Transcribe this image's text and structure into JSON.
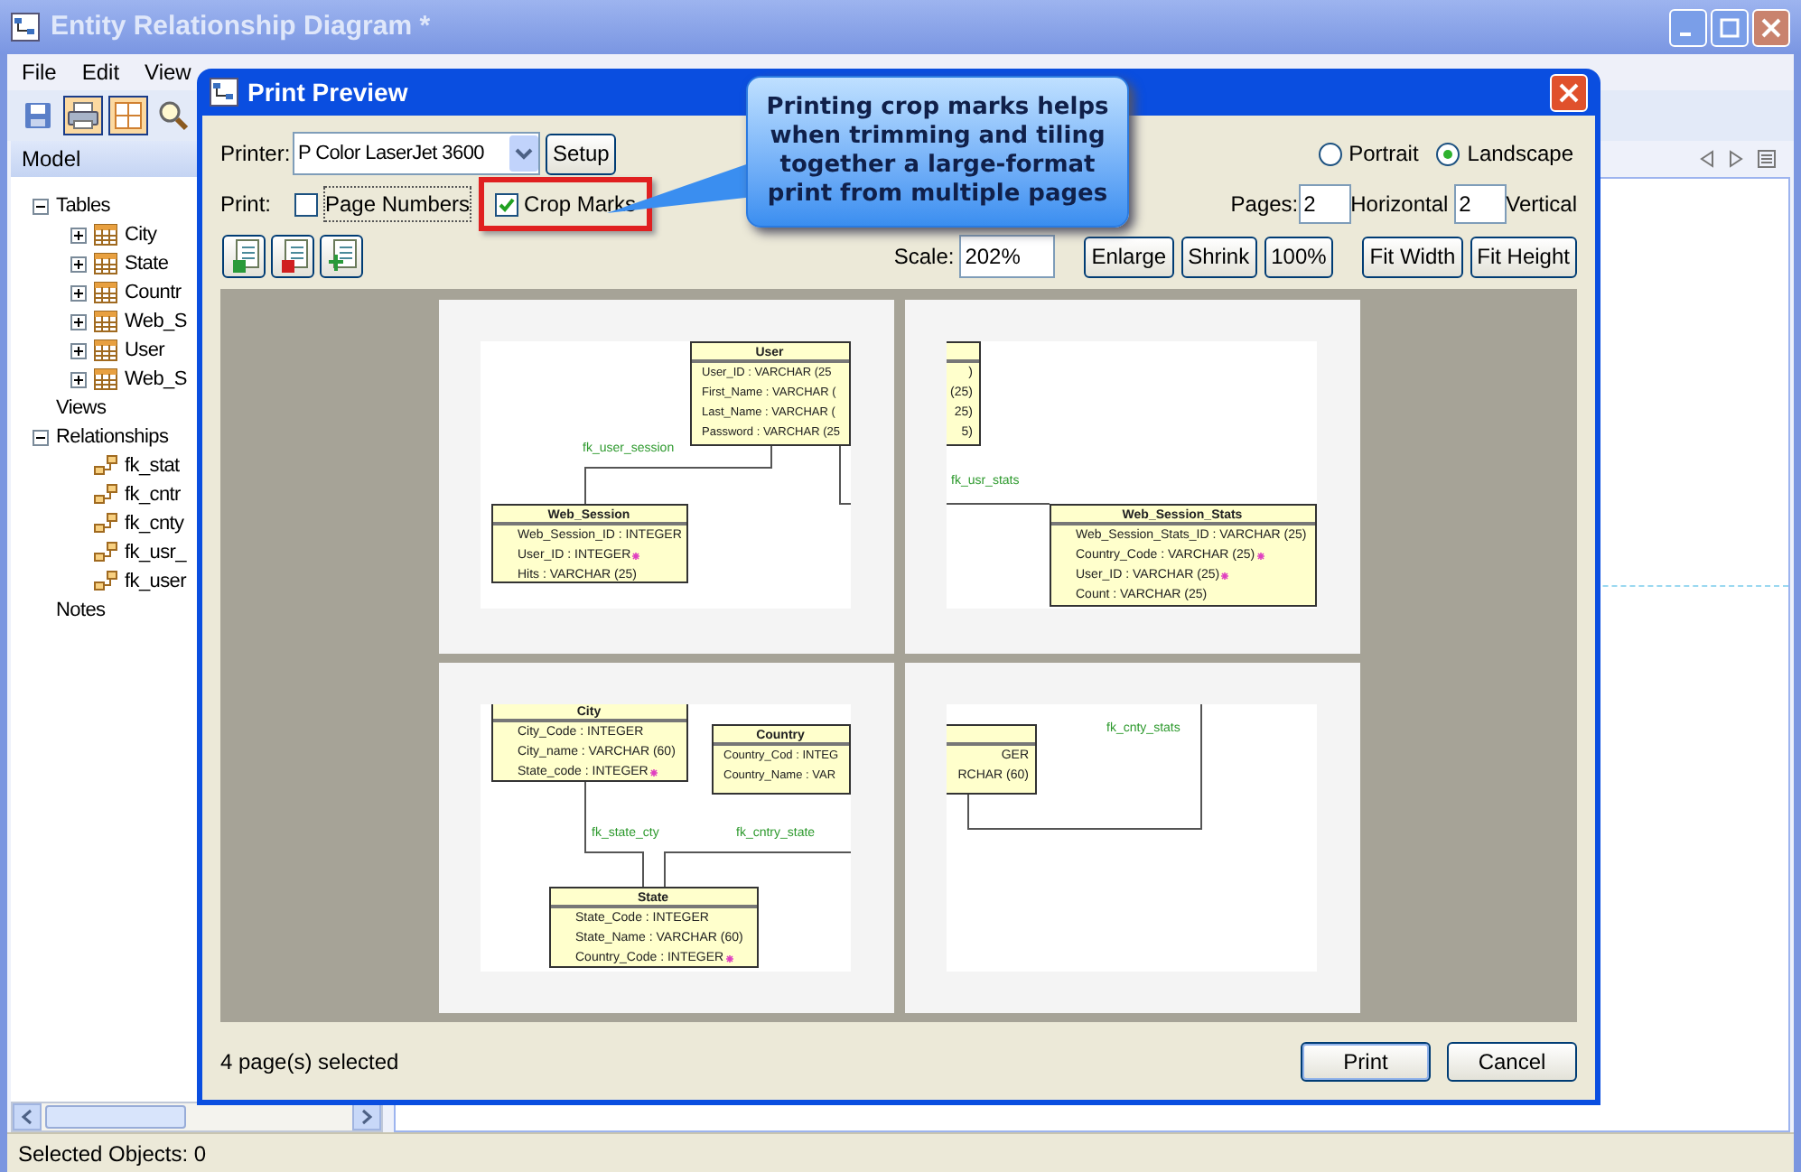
{
  "main_window": {
    "title": "Entity Relationship Diagram *"
  },
  "menu": [
    "File",
    "Edit",
    "View"
  ],
  "toolbar": [
    {
      "kind": "save",
      "pressed": false
    },
    {
      "kind": "print",
      "pressed": true
    },
    {
      "kind": "page",
      "pressed": true
    },
    {
      "kind": "zoom",
      "pressed": false
    }
  ],
  "model_panel": {
    "title": "Model",
    "tree": [
      {
        "label": "Tables",
        "kind": "folder",
        "expanded": true,
        "children": [
          {
            "label": "City",
            "kind": "table",
            "expanded": false
          },
          {
            "label": "State",
            "kind": "table",
            "expanded": false
          },
          {
            "label": "Countr",
            "kind": "table",
            "expanded": false
          },
          {
            "label": "Web_S",
            "kind": "table",
            "expanded": false
          },
          {
            "label": "User",
            "kind": "table",
            "expanded": false
          },
          {
            "label": "Web_S",
            "kind": "table",
            "expanded": false
          }
        ]
      },
      {
        "label": "Views",
        "kind": "plain"
      },
      {
        "label": "Relationships",
        "kind": "folder",
        "expanded": true,
        "children": [
          {
            "label": "fk_stat",
            "kind": "relation"
          },
          {
            "label": "fk_cntr",
            "kind": "relation"
          },
          {
            "label": "fk_cnty",
            "kind": "relation"
          },
          {
            "label": "fk_usr_",
            "kind": "relation"
          },
          {
            "label": "fk_user",
            "kind": "relation"
          }
        ]
      },
      {
        "label": "Notes",
        "kind": "plain"
      }
    ]
  },
  "status_bar": "Selected Objects: 0",
  "dialog": {
    "title": "Print Preview",
    "printer": {
      "label": "Printer:",
      "value": "P Color LaserJet 3600",
      "setup": "Setup"
    },
    "print_label": "Print:",
    "options": [
      {
        "label": "Page Numbers",
        "checked": false,
        "highlighted": false
      },
      {
        "label": "Crop Marks",
        "checked": true,
        "highlighted": true
      }
    ],
    "orientation": [
      {
        "label": "Portrait",
        "selected": false
      },
      {
        "label": "Landscape",
        "selected": true
      }
    ],
    "pages": {
      "label": "Pages:",
      "horizontal": "2",
      "horizontal_label": "Horizontal",
      "vertical": "2",
      "vertical_label": "Vertical"
    },
    "page_tools": [
      {
        "kind": "select_all"
      },
      {
        "kind": "deselect"
      },
      {
        "kind": "add"
      }
    ],
    "scale": {
      "label": "Scale:",
      "value": "202%"
    },
    "zoom_buttons": [
      "Enlarge",
      "Shrink",
      "100%"
    ],
    "fit_buttons": [
      "Fit Width",
      "Fit Height"
    ],
    "preview_pages": [
      {
        "entities": [
          {
            "title": "User",
            "fields": [
              {
                "text": "User_ID : VARCHAR (25",
                "fk": false
              },
              {
                "text": "First_Name : VARCHAR (",
                "fk": false
              },
              {
                "text": "Last_Name : VARCHAR (",
                "fk": false
              },
              {
                "text": "Password : VARCHAR (25",
                "fk": false
              }
            ]
          },
          {
            "title": "Web_Session",
            "fields": [
              {
                "text": "Web_Session_ID : INTEGER",
                "fk": false
              },
              {
                "text": "User_ID : INTEGER",
                "fk": true
              },
              {
                "text": "Hits : VARCHAR (25)",
                "fk": false
              }
            ]
          }
        ],
        "labels": [
          "fk_user_session"
        ]
      },
      {
        "entities": [
          {
            "fields": [
              {
                "text": ")",
                "fk": false
              },
              {
                "text": "(25)",
                "fk": false
              },
              {
                "text": "25)",
                "fk": false
              },
              {
                "text": "5)",
                "fk": false
              }
            ]
          },
          {
            "title": "Web_Session_Stats",
            "fields": [
              {
                "text": "Web_Session_Stats_ID : VARCHAR (25)",
                "fk": false
              },
              {
                "text": "Country_Code : VARCHAR (25)",
                "fk": true
              },
              {
                "text": "User_ID : VARCHAR (25)",
                "fk": true
              },
              {
                "text": "Count : VARCHAR (25)",
                "fk": false
              }
            ]
          }
        ],
        "labels": [
          "fk_usr_stats"
        ]
      },
      {
        "entities": [
          {
            "title": "City",
            "fields": [
              {
                "text": "City_Code : INTEGER",
                "fk": false
              },
              {
                "text": "City_name : VARCHAR (60)",
                "fk": false
              },
              {
                "text": "State_code : INTEGER",
                "fk": true
              }
            ]
          },
          {
            "title": "Country",
            "fields": [
              {
                "text": "Country_Cod : INTEG",
                "fk": false
              },
              {
                "text": "Country_Name : VAR",
                "fk": false
              }
            ]
          },
          {
            "title": "State",
            "fields": [
              {
                "text": "State_Code : INTEGER",
                "fk": false
              },
              {
                "text": "State_Name : VARCHAR (60)",
                "fk": false
              },
              {
                "text": "Country_Code : INTEGER",
                "fk": true
              }
            ]
          }
        ],
        "labels": [
          "fk_state_cty",
          "fk_cntry_state"
        ]
      },
      {
        "entities": [
          {
            "fields": [
              {
                "text": "GER",
                "fk": false
              },
              {
                "text": "RCHAR (60)",
                "fk": false
              }
            ]
          }
        ],
        "labels": [
          "fk_cnty_stats"
        ]
      }
    ],
    "selection_status": "4 page(s) selected",
    "buttons": [
      "Print",
      "Cancel"
    ]
  },
  "callout": "Printing crop marks helps when trimming and tiling together a large-format print from multiple pages"
}
